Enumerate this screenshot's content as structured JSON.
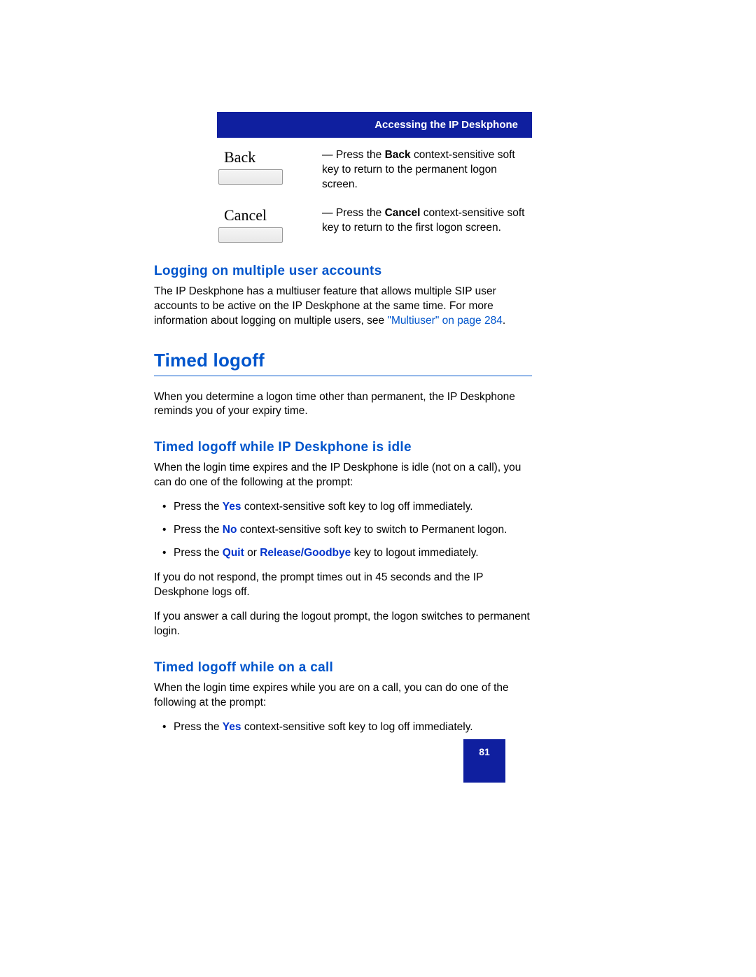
{
  "header": {
    "title": "Accessing the IP Deskphone"
  },
  "softkeys": [
    {
      "label": "Back",
      "dash": "—",
      "pre": "Press the ",
      "key": "Back",
      "post": " context-sensitive soft key to return to the permanent logon screen."
    },
    {
      "label": "Cancel",
      "dash": "—",
      "pre": "Press the ",
      "key": "Cancel",
      "post": " context-sensitive soft key to return to the first logon screen."
    }
  ],
  "sections": {
    "multi_h3": "Logging on multiple user accounts",
    "multi_p_pre": "The IP Deskphone has a multiuser feature that allows multiple SIP user accounts to be active on the IP Deskphone at the same time. For more information about logging on multiple users, see ",
    "multi_link": "\"Multiuser\" on page 284",
    "multi_p_post": ".",
    "timed_h2": "Timed logoff",
    "timed_intro": "When you determine a logon time other than permanent, the IP Deskphone reminds you of your expiry time.",
    "idle_h3": "Timed logoff while IP Deskphone is idle",
    "idle_p1": "When the login time expires and the IP Deskphone is idle (not on a call), you can do one of the following at the prompt:",
    "idle_bullets": [
      {
        "pre": "Press the ",
        "k1": "Yes",
        "mid": " context-sensitive soft key to log off immediately.",
        "k2": "",
        "post": ""
      },
      {
        "pre": "Press the ",
        "k1": "No",
        "mid": " context-sensitive soft key to switch to Permanent logon.",
        "k2": "",
        "post": ""
      },
      {
        "pre": "Press the ",
        "k1": "Quit",
        "mid": " or ",
        "k2": "Release/Goodbye",
        "post": " key to logout immediately."
      }
    ],
    "idle_p2": "If you do not respond, the prompt times out in 45 seconds and the IP Deskphone logs off.",
    "idle_p3": "If you answer a call during the logout prompt, the logon switches to permanent login.",
    "call_h3": "Timed logoff while on a call",
    "call_p1": "When the login time expires while you are on a call, you can do one of the following at the prompt:",
    "call_bullets": [
      {
        "pre": "Press the ",
        "k1": "Yes",
        "mid": " context-sensitive soft key to log off immediately.",
        "k2": "",
        "post": ""
      }
    ]
  },
  "page_number": "81"
}
